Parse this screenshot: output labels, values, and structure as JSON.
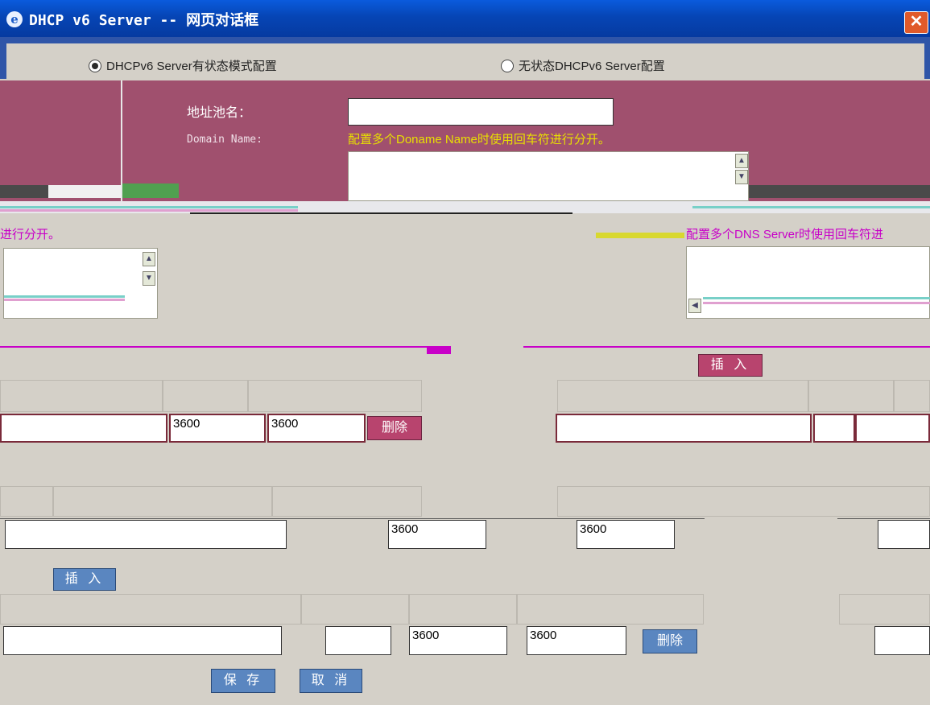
{
  "window": {
    "title": "DHCP v6 Server -- 网页对话框",
    "icon": "ie-icon",
    "close_glyph": "✕"
  },
  "mode_radios": [
    {
      "label": "DHCPv6 Server有状态模式配置",
      "selected": true
    },
    {
      "label": "无状态DHCPv6 Server配置",
      "selected": false
    }
  ],
  "pool": {
    "name_label": "地址池名：",
    "name_value": "",
    "domain_label": "Domain Name:",
    "domain_hint": "配置多个Doname Name时使用回车符进行分开。"
  },
  "left_hint_fragment": "进行分开。",
  "dns": {
    "hint": "配置多个DNS Server时使用回车符进"
  },
  "buttons": {
    "insert": "插 入",
    "delete": "删除",
    "save": "保 存",
    "cancel": "取 消"
  },
  "prefix_table_row": {
    "prefix": "",
    "preferred_lifetime": "3600",
    "valid_lifetime": "3600"
  },
  "address_table_row": {
    "address": "",
    "preferred_lifetime": "3600",
    "valid_lifetime": "3600"
  },
  "bottom_table_row": {
    "address": "",
    "length": "",
    "preferred_lifetime": "3600",
    "valid_lifetime": "3600"
  },
  "colors": {
    "titlebar": "#0645b5",
    "magenta_panel": "#a0506e",
    "hint_yellow": "#e8e000",
    "hint_magenta": "#c800c8",
    "button_pink": "#b8446e",
    "button_blue": "#5a86c0"
  }
}
